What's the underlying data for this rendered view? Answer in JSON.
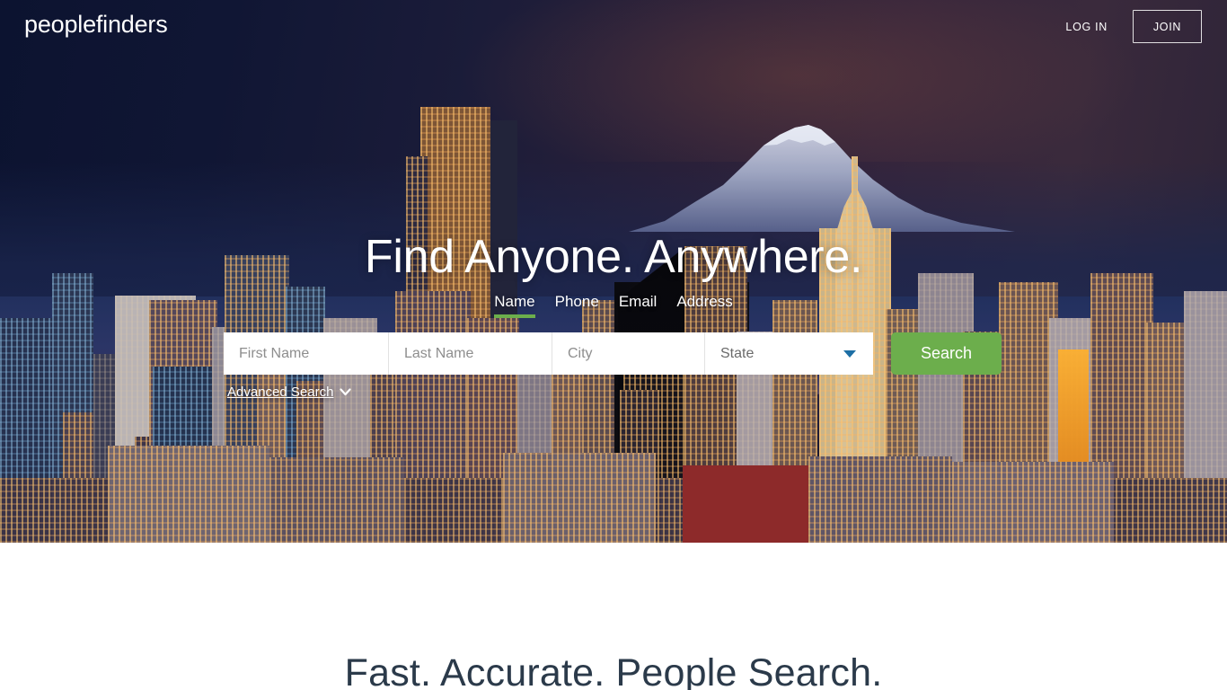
{
  "header": {
    "logo": "peoplefinders",
    "login_label": "LOG IN",
    "join_label": "JOIN"
  },
  "hero": {
    "headline": "Find Anyone. Anywhere.",
    "tabs": [
      {
        "label": "Name",
        "active": true
      },
      {
        "label": "Phone",
        "active": false
      },
      {
        "label": "Email",
        "active": false
      },
      {
        "label": "Address",
        "active": false
      }
    ],
    "search": {
      "first_name_placeholder": "First Name",
      "first_name_value": "",
      "last_name_placeholder": "Last Name",
      "last_name_value": "",
      "city_placeholder": "City",
      "city_value": "",
      "state_selected": "State",
      "state_caret_icon": "chevron-down-icon",
      "search_button_label": "Search"
    },
    "advanced_search_label": "Advanced Search",
    "advanced_search_icon": "chevron-down-icon",
    "background_description": "Seattle skyline at dusk with Mount Rainier"
  },
  "below_fold": {
    "section_title": "Fast. Accurate. People Search."
  },
  "colors": {
    "accent_green": "#6cae4c",
    "caret_blue": "#1d6fa5",
    "heading_dark": "#2b3a4a",
    "header_text": "#ffffff"
  }
}
